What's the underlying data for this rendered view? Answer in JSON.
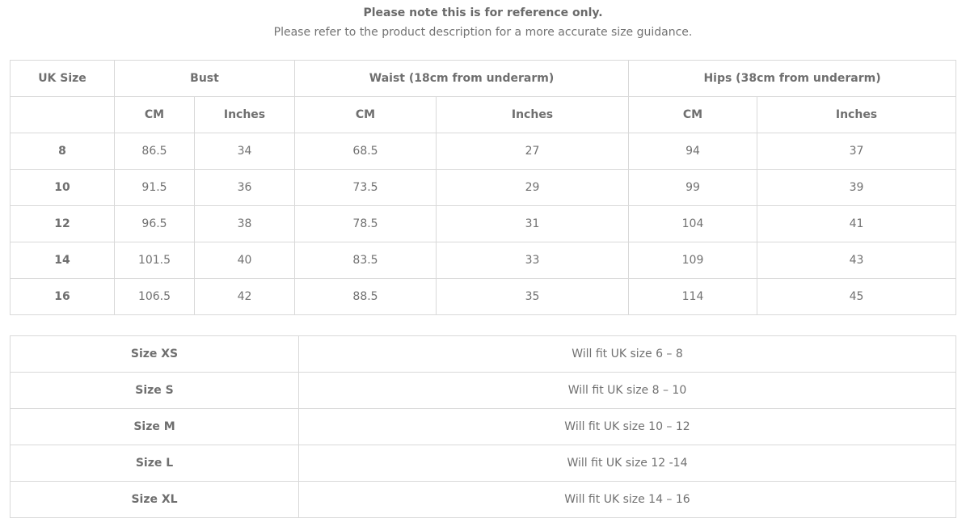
{
  "notes": {
    "line1": "Please note this is for reference only.",
    "line2": "Please refer to the product description for a more accurate size guidance."
  },
  "size_table": {
    "headers": {
      "uk_size": "UK Size",
      "bust": "Bust",
      "waist": "Waist (18cm from underarm)",
      "hips": "Hips (38cm from underarm)"
    },
    "subheaders": [
      "",
      "CM",
      "Inches",
      "CM",
      "Inches",
      "CM",
      "Inches"
    ],
    "rows": [
      [
        "8",
        "86.5",
        "34",
        "68.5",
        "27",
        "94",
        "37"
      ],
      [
        "10",
        "91.5",
        "36",
        "73.5",
        "29",
        "99",
        "39"
      ],
      [
        "12",
        "96.5",
        "38",
        "78.5",
        "31",
        "104",
        "41"
      ],
      [
        "14",
        "101.5",
        "40",
        "83.5",
        "33",
        "109",
        "43"
      ],
      [
        "16",
        "106.5",
        "42",
        "88.5",
        "35",
        "114",
        "45"
      ]
    ]
  },
  "fit_table": {
    "rows": [
      [
        "Size XS",
        "Will fit UK size 6 – 8"
      ],
      [
        "Size S",
        "Will fit UK size 8 – 10"
      ],
      [
        "Size M",
        "Will fit UK size 10 – 12"
      ],
      [
        "Size L",
        "Will fit UK size 12 -14"
      ],
      [
        "Size XL",
        "Will fit UK size 14 – 16"
      ]
    ]
  }
}
